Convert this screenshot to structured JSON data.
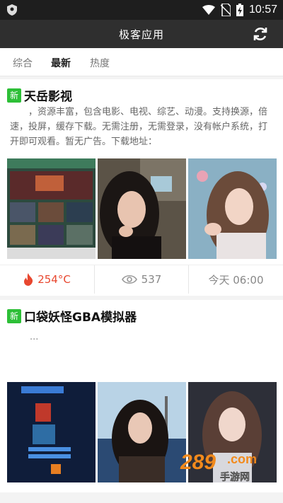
{
  "status": {
    "time": "10:57",
    "icons": [
      "shield-icon",
      "wifi-icon",
      "no-sim-icon",
      "battery-icon"
    ]
  },
  "app": {
    "title": "极客应用",
    "refresh_icon": "refresh-icon"
  },
  "tabs": [
    {
      "label": "综合",
      "active": false
    },
    {
      "label": "最新",
      "active": true
    },
    {
      "label": "热度",
      "active": false
    }
  ],
  "cards": [
    {
      "badge": "新",
      "title": "天岳影视",
      "description": "，资源丰富，包含电影、电视、综艺、动漫。支持换源，倍速，投屏，缓存下载。无需注册，无需登录，没有帐户系统，打开即可观看。暂无广告。下载地址：",
      "thumbnails": [
        "app-screenshot",
        "portrait-photo",
        "portrait-photo"
      ],
      "heat": "254°C",
      "views": "537",
      "time": "今天 06:00"
    },
    {
      "badge": "新",
      "title": "口袋妖怪GBA模拟器",
      "description": "...",
      "thumbnails": [
        "app-screenshot",
        "portrait-photo",
        "portrait-photo"
      ]
    }
  ],
  "watermark": {
    "text_main": "289",
    "text_suffix": ".com",
    "text_sub": "手游网"
  },
  "colors": {
    "status_bar": "#1e1e1e",
    "app_bar": "#2f2f2f",
    "badge_green": "#2dbf37",
    "heat_red": "#e8472f"
  }
}
